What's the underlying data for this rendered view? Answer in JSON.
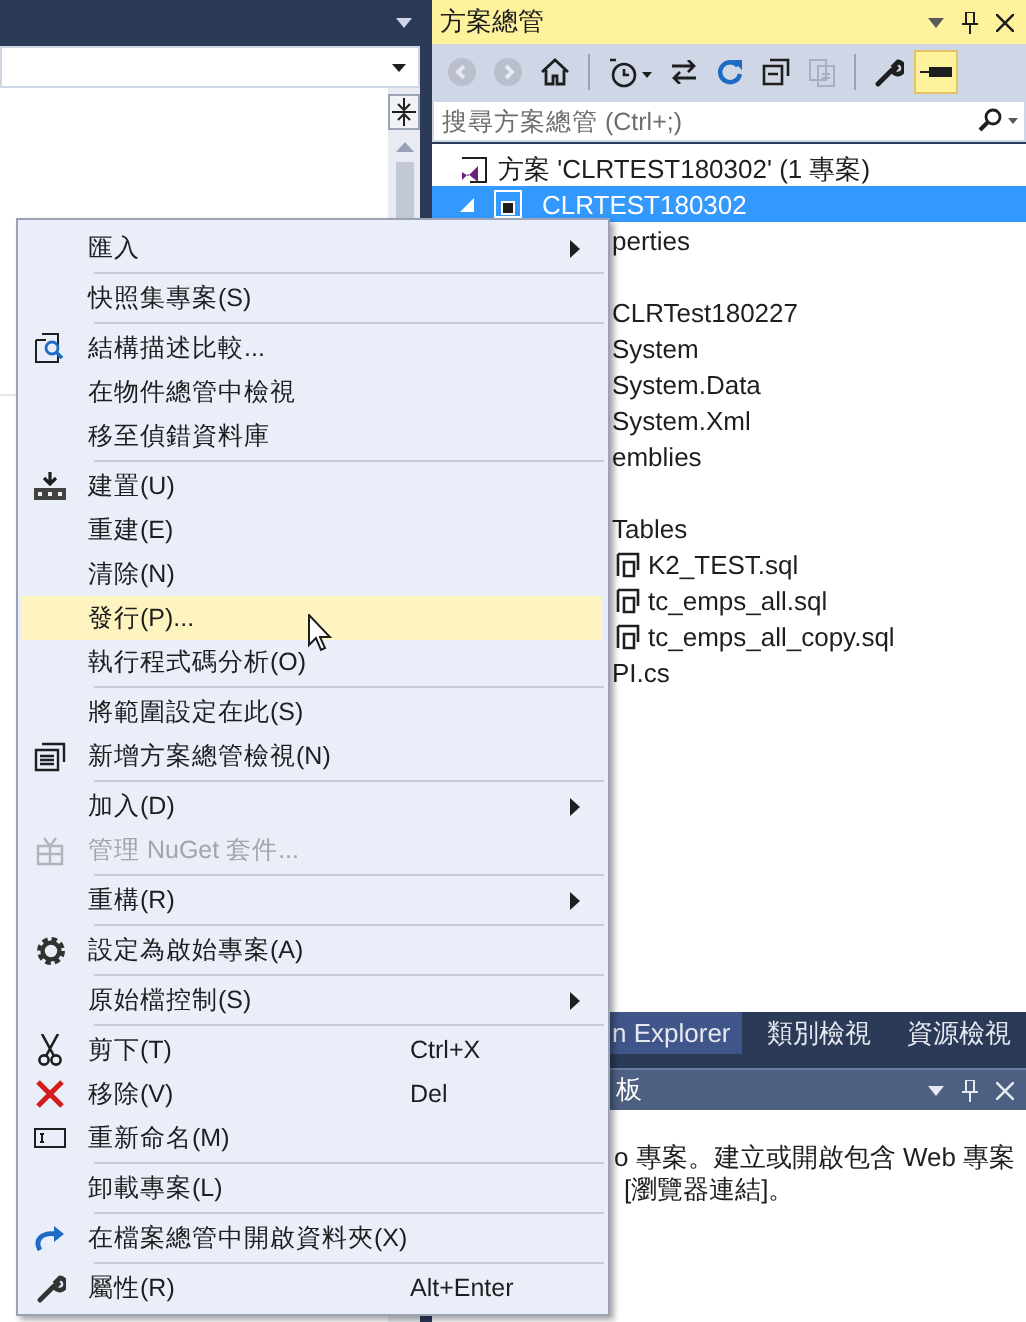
{
  "solution_explorer": {
    "title": "方案總管",
    "search": {
      "placeholder": "搜尋方案總管 (Ctrl+;)"
    },
    "tree": [
      {
        "kind": "solution",
        "text": "方案 'CLRTEST180302' (1 專案)",
        "selected": false
      },
      {
        "kind": "project",
        "text": "CLRTEST180302",
        "selected": true
      },
      {
        "kind": "item",
        "text": "perties",
        "selected": false
      },
      {
        "kind": "covered"
      },
      {
        "kind": "item",
        "text": "CLRTest180227",
        "selected": false
      },
      {
        "kind": "item",
        "text": "System",
        "selected": false
      },
      {
        "kind": "item",
        "text": "System.Data",
        "selected": false
      },
      {
        "kind": "item",
        "text": "System.Xml",
        "selected": false
      },
      {
        "kind": "item",
        "text": "emblies",
        "selected": false
      },
      {
        "kind": "covered"
      },
      {
        "kind": "item",
        "text": "Tables",
        "selected": false
      },
      {
        "kind": "file",
        "text": "K2_TEST.sql",
        "selected": false
      },
      {
        "kind": "file",
        "text": "tc_emps_all.sql",
        "selected": false
      },
      {
        "kind": "file",
        "text": "tc_emps_all_copy.sql",
        "selected": false
      },
      {
        "kind": "item",
        "text": "PI.cs",
        "selected": false
      }
    ],
    "tabs": [
      {
        "label": "n Explorer",
        "selected": true
      },
      {
        "label": "類別檢視",
        "selected": false
      },
      {
        "label": "資源檢視",
        "selected": false
      }
    ]
  },
  "bottom_panel": {
    "title": "板",
    "lines": [
      "o 專案。建立或開啟包含 Web 專案",
      "[瀏覽器連結]。"
    ]
  },
  "context_menu": [
    {
      "kind": "item",
      "label": "匯入",
      "submenu": true,
      "disabled": false,
      "selected": false
    },
    {
      "kind": "separator"
    },
    {
      "kind": "item",
      "label": "快照集專案(S)",
      "disabled": false,
      "selected": false
    },
    {
      "kind": "separator"
    },
    {
      "kind": "item",
      "label": "結構描述比較...",
      "disabled": false,
      "selected": false
    },
    {
      "kind": "item",
      "label": "在物件總管中檢視",
      "disabled": false,
      "selected": false
    },
    {
      "kind": "item",
      "label": "移至偵錯資料庫",
      "disabled": false,
      "selected": false
    },
    {
      "kind": "separator"
    },
    {
      "kind": "item",
      "label": "建置(U)",
      "disabled": false,
      "selected": false
    },
    {
      "kind": "item",
      "label": "重建(E)",
      "disabled": false,
      "selected": false
    },
    {
      "kind": "item",
      "label": "清除(N)",
      "disabled": false,
      "selected": false
    },
    {
      "kind": "item",
      "label": "發行(P)...",
      "disabled": false,
      "selected": true
    },
    {
      "kind": "item",
      "label": "執行程式碼分析(O)",
      "disabled": false,
      "selected": false
    },
    {
      "kind": "separator"
    },
    {
      "kind": "item",
      "label": "將範圍設定在此(S)",
      "disabled": false,
      "selected": false
    },
    {
      "kind": "item",
      "label": "新增方案總管檢視(N)",
      "disabled": false,
      "selected": false
    },
    {
      "kind": "separator"
    },
    {
      "kind": "item",
      "label": "加入(D)",
      "submenu": true,
      "disabled": false,
      "selected": false
    },
    {
      "kind": "item",
      "label": "管理 NuGet 套件...",
      "disabled": true,
      "selected": false
    },
    {
      "kind": "separator"
    },
    {
      "kind": "item",
      "label": "重構(R)",
      "submenu": true,
      "disabled": false,
      "selected": false
    },
    {
      "kind": "separator"
    },
    {
      "kind": "item",
      "label": "設定為啟始專案(A)",
      "disabled": false,
      "selected": false
    },
    {
      "kind": "separator"
    },
    {
      "kind": "item",
      "label": "原始檔控制(S)",
      "submenu": true,
      "disabled": false,
      "selected": false
    },
    {
      "kind": "separator"
    },
    {
      "kind": "item",
      "label": "剪下(T)",
      "shortcut": "Ctrl+X",
      "disabled": false,
      "selected": false
    },
    {
      "kind": "item",
      "label": "移除(V)",
      "shortcut": "Del",
      "disabled": false,
      "selected": false
    },
    {
      "kind": "item",
      "label": "重新命名(M)",
      "disabled": false,
      "selected": false
    },
    {
      "kind": "separator"
    },
    {
      "kind": "item",
      "label": "卸載專案(L)",
      "disabled": false,
      "selected": false
    },
    {
      "kind": "separator"
    },
    {
      "kind": "item",
      "label": "在檔案總管中開啟資料夾(X)",
      "disabled": false,
      "selected": false
    },
    {
      "kind": "separator"
    },
    {
      "kind": "item",
      "label": "屬性(R)",
      "shortcut": "Alt+Enter",
      "disabled": false,
      "selected": false
    }
  ]
}
